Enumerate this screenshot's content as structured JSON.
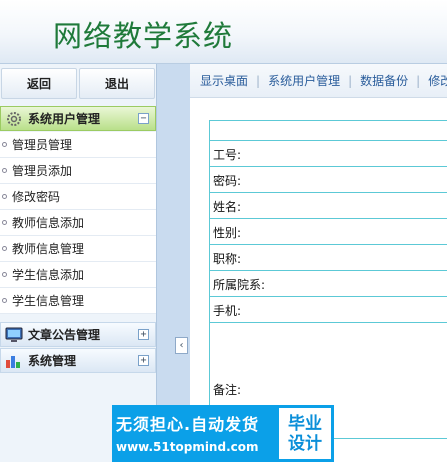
{
  "header": {
    "title": "网络教学系统"
  },
  "left": {
    "back_label": "返回",
    "logout_label": "退出",
    "section_user": "系统用户管理",
    "section_user_toggle": "−",
    "menu": [
      "管理员管理",
      "管理员添加",
      "修改密码",
      "教师信息添加",
      "教师信息管理",
      "学生信息添加",
      "学生信息管理"
    ],
    "section_article": "文章公告管理",
    "section_system": "系统管理",
    "collapsed_toggle": "+"
  },
  "nav": {
    "items": [
      "显示桌面",
      "系统用户管理",
      "数据备份",
      "修改"
    ],
    "separator": "|"
  },
  "form": {
    "fields": [
      "工号:",
      "密码:",
      "姓名:",
      "性别:",
      "职称:",
      "所属院系:",
      "手机:"
    ],
    "remarks": "备注:"
  },
  "splitter": {
    "arrow": "‹"
  },
  "watermark": {
    "line1": "无须担心.自动发货",
    "line2": "www.51topmind.com",
    "badge1": "毕业",
    "badge2": "设计"
  },
  "colors": {
    "title_green": "#1f7a3a",
    "active_green": "#b9e08a",
    "table_border": "#5cc9d6",
    "nav_link": "#2a5d9b",
    "watermark_blue": "#0ba0e8"
  }
}
